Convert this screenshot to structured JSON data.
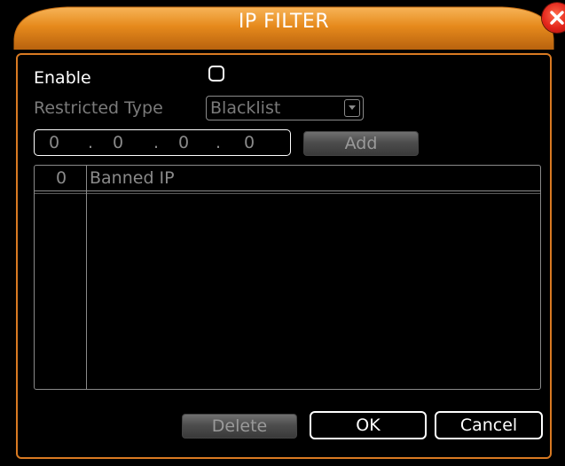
{
  "dialog": {
    "title": "IP FILTER",
    "close_icon": "close-icon"
  },
  "form": {
    "enable_label": "Enable",
    "enable_checked": false,
    "restricted_type_label": "Restricted Type",
    "restricted_type_value": "Blacklist",
    "ip_segments": [
      "0",
      "0",
      "0",
      "0"
    ],
    "ip_separators": [
      ".",
      ".",
      "."
    ],
    "add_label": "Add"
  },
  "table": {
    "headers": [
      "0",
      "Banned IP"
    ],
    "rows": []
  },
  "footer": {
    "delete_label": "Delete",
    "ok_label": "OK",
    "cancel_label": "Cancel"
  },
  "colors": {
    "title_orange": "#e8901f",
    "border_orange": "#d97a22",
    "close_red": "#e2231a",
    "disabled_text": "#7a7a7a"
  }
}
